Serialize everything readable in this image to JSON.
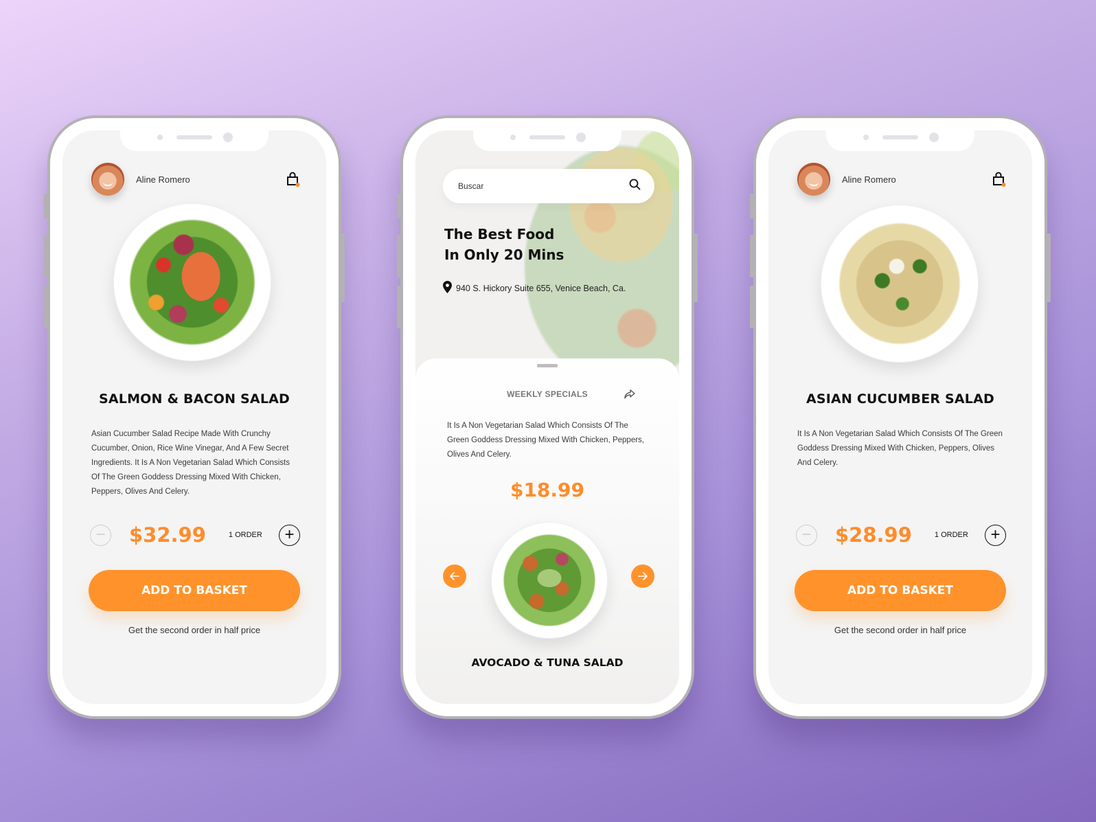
{
  "colors": {
    "accent": "#FF922B",
    "price": "#FF8C2A",
    "background_start": "#ECD4FA",
    "background_end": "#8368BD"
  },
  "phones": [
    {
      "user": {
        "name": "Aline Romero",
        "avatar_icon": "user-avatar"
      },
      "cart_icon": "shopping-bag-icon",
      "product": {
        "title": "SALMON & BACON  SALAD",
        "description": "Asian Cucumber Salad Recipe Made With Crunchy Cucumber, Onion, Rice Wine Vinegar, And A Few Secret Ingredients. It Is A Non Vegetarian Salad Which Consists Of The Green Goddess Dressing Mixed With Chicken, Peppers, Olives And Celery.",
        "price": "$32.99",
        "order_count": "1 ORDER",
        "minus_icon": "−",
        "plus_icon": "+"
      },
      "add_button": "ADD TO BASKET",
      "promo": "Get the second order in half price"
    },
    {
      "search": {
        "placeholder": "Buscar",
        "value": ""
      },
      "hero": {
        "title_line1": "The Best Food",
        "title_line2": "In Only 20 Mins",
        "address": "940 S. Hickory Suite 655, Venice Beach, Ca."
      },
      "sheet": {
        "title": "WEEKLY SPECIALS",
        "description": "It Is A Non Vegetarian Salad Which Consists Of The Green Goddess Dressing Mixed With Chicken, Peppers, Olives And Celery.",
        "price": "$18.99",
        "product_name": "AVOCADO & TUNA SALAD"
      }
    },
    {
      "user": {
        "name": "Aline Romero",
        "avatar_icon": "user-avatar"
      },
      "cart_icon": "shopping-bag-icon",
      "product": {
        "title": "ASIAN CUCUMBER SALAD",
        "description": "It Is A Non Vegetarian Salad Which Consists Of The Green Goddess Dressing Mixed With Chicken, Peppers, Olives And Celery.",
        "price": "$28.99",
        "order_count": "1 ORDER",
        "minus_icon": "−",
        "plus_icon": "+"
      },
      "add_button": "ADD TO BASKET",
      "promo": "Get the second order in half price"
    }
  ]
}
